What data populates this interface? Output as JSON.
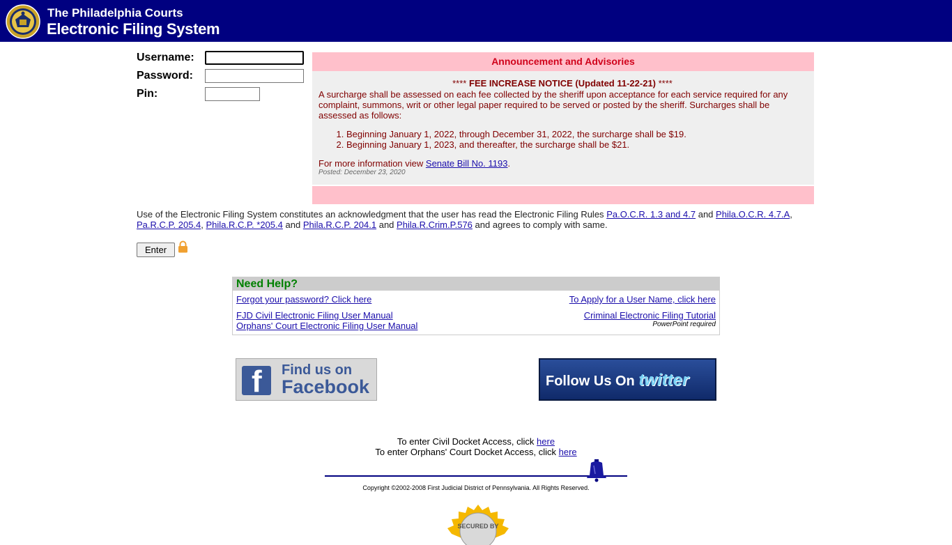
{
  "header": {
    "line1": "The Philadelphia Courts",
    "line2": "Electronic Filing System"
  },
  "login": {
    "username_label": "Username:",
    "password_label": "Password:",
    "pin_label": "Pin:",
    "username_value": "",
    "password_value": "",
    "pin_value": ""
  },
  "announcement": {
    "heading": "Announcement and Advisories",
    "title_prefix": "****",
    "title": "FEE INCREASE NOTICE (Updated 11-22-21)",
    "title_suffix": "****",
    "body": "A surcharge shall be assessed on each fee collected by the sheriff upon acceptance for each service required for any complaint, summons, writ or other legal paper required to be served or posted by the sheriff. Surcharges shall be assessed as follows:",
    "items": [
      "Beginning January 1, 2022, through December 31, 2022, the surcharge shall be $19.",
      "Beginning January 1, 2023, and thereafter, the surcharge shall be $21."
    ],
    "more_prefix": "For more information view",
    "more_link": "Senate Bill No. 1193",
    "more_suffix": ".",
    "posted": "Posted: December 23, 2020"
  },
  "ack": {
    "t1": "Use of the Electronic Filing System constitutes an acknowledgment that the user has read the Electronic Filing Rules",
    "l1": "Pa.O.C.R. 1.3 and 4.7",
    "t2": "and",
    "l2": "Phila.O.C.R. 4.7.A",
    "t3": ",",
    "l3": "Pa.R.C.P. 205.4",
    "t4": ",",
    "l4": "Phila.R.C.P. *205.4",
    "t5": "and",
    "l5": "Phila.R.C.P. 204.1",
    "t6": "and",
    "l6": "Phila.R.Crim.P.576",
    "t7": "and agrees to comply with same."
  },
  "enter_label": "Enter",
  "help": {
    "title": "Need Help?",
    "forgot": "Forgot your password? Click here",
    "apply": "To Apply for a User Name, click here",
    "civil_manual": "FJD Civil Electronic Filing User Manual",
    "orphans_manual": "Orphans' Court Electronic Filing User Manual",
    "criminal_tutorial": "Criminal Electronic Filing Tutorial",
    "pp_note": "PowerPoint required"
  },
  "social": {
    "fb_line1": "Find us on",
    "fb_line2": "Facebook",
    "fb_letter": "f",
    "tw_prefix": "Follow Us On",
    "tw_brand": "twitter"
  },
  "docket": {
    "civil_text": "To enter Civil Docket Access, click",
    "civil_link": "here",
    "orphans_text": "To enter Orphans' Court Docket Access, click",
    "orphans_link": "here"
  },
  "copyright": "Copyright ©2002-2008 First Judicial District of Pennsylvania. All Rights Reserved.",
  "badge_text": "SECURED BY",
  "colors": {
    "header_bg": "#000080",
    "ann_head_bg": "#ffc0cb",
    "ann_text": "#800000",
    "help_title": "#008000"
  }
}
